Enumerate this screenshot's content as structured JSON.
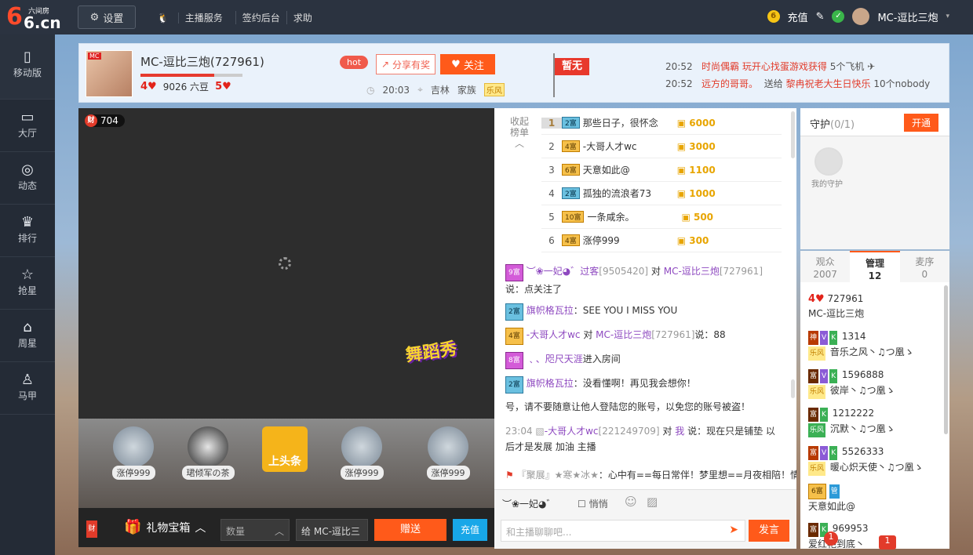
{
  "logo": {
    "text": "6.cn",
    "sub": "六间房"
  },
  "topbar": {
    "settings": "设置",
    "nav": [
      "主播服务",
      "签约后台",
      "求助"
    ],
    "recharge": "充值",
    "username": "MC-逗比三炮"
  },
  "leftnav": [
    {
      "label": "移动版",
      "icon": "phone-icon"
    },
    {
      "label": "大厅",
      "icon": "tv-icon"
    },
    {
      "label": "动态",
      "icon": "compass-icon"
    },
    {
      "label": "排行",
      "icon": "crown-icon"
    },
    {
      "label": "抢星",
      "icon": "star-icon"
    },
    {
      "label": "周星",
      "icon": "gift-icon"
    },
    {
      "label": "马甲",
      "icon": "shirt-icon"
    }
  ],
  "header": {
    "name": "MC-逗比三炮(727961)",
    "level_left": "4",
    "beans": "9026 六豆",
    "level_right": "5",
    "hot": "hot",
    "share": "分享有奖",
    "follow": "关注",
    "time": "20:03",
    "location": "吉林",
    "family_label": "家族",
    "family": "乐风",
    "flag": "暂无",
    "progress": 0.72
  },
  "news": [
    {
      "time": "20:52",
      "red": "时尚偶霸 玩开心找蛋游戏获得",
      "black": "5个飞机"
    },
    {
      "time": "20:52",
      "red": "远方的哥哥。",
      "black": "送给",
      "red2": "黎冉祝老大生日快乐",
      "black2": "10个nobody"
    }
  ],
  "video": {
    "rich_label": "财",
    "rich_count": "704",
    "overlay": "舞蹈秀"
  },
  "gifts": [
    {
      "label": "涨停999"
    },
    {
      "label": "珺倾军の茶"
    },
    {
      "label": "上头条"
    },
    {
      "label": "涨停999"
    },
    {
      "label": "涨停999"
    }
  ],
  "giftbar": {
    "cai": "财",
    "giftbox": "礼物宝箱",
    "qty_placeholder": "数量",
    "to_label": "给",
    "to_name": "MC-逗比三",
    "send": "赠送",
    "recharge": "充值"
  },
  "rank": {
    "toggle": "收起榜单",
    "rows": [
      {
        "no": "1",
        "badge": "2富",
        "name": "那些日子，很怀念",
        "coins": "6000"
      },
      {
        "no": "2",
        "badge": "4富",
        "name": "-大哥人才wc",
        "coins": "3000"
      },
      {
        "no": "3",
        "badge": "6富",
        "name": "天意如此@",
        "coins": "1100"
      },
      {
        "no": "4",
        "badge": "2富",
        "name": "孤独的流浪者73",
        "coins": "1000"
      },
      {
        "no": "5",
        "badge": "10富",
        "name": "一条咸余。",
        "coins": "500"
      },
      {
        "no": "6",
        "badge": "4富",
        "name": "涨停999",
        "coins": "300"
      }
    ]
  },
  "chat": [
    {
      "badge": "9富",
      "who": "︶❀一妃◕゛过客",
      "id": "[9505420]",
      "to": "对",
      "target": "MC-逗比三炮",
      "tid": "[727961]",
      "msg": "说：点关注了"
    },
    {
      "badge": "2富",
      "who": "旗帜格瓦拉",
      "msg": "：SEE YOU I MISS YOU"
    },
    {
      "badge": "4富",
      "who": "-大哥人才wc",
      "to": "对",
      "target": "MC-逗比三炮",
      "tid": "[727961]",
      "msg": "说：88"
    },
    {
      "badge": "8富",
      "who": "﹑、咫尺天涯",
      "msg": "进入房间"
    },
    {
      "badge": "2富",
      "who": "旗帜格瓦拉",
      "msg": "：没看懂啊！再见我会想你！"
    },
    {
      "warn": "号，请不要随意让他人登陆您的账号，以免您的账号被盗！"
    },
    {
      "time": "23:04",
      "who": "-大哥人才wc",
      "id": "[221249709]",
      "to": "对",
      "target": "我",
      "msg": "说：现在只是铺垫 以后才是发展 加油 主播"
    },
    {
      "who": "『聚展』★寒★冰★",
      "msg": "：心中有==每日常伴！梦里想==月夜相陪！情"
    }
  ],
  "chatbar": {
    "sender": "︶❀一妃◕゛",
    "quiet": "悄悄",
    "placeholder": "和主播聊聊吧...",
    "send": "发言"
  },
  "guard": {
    "title": "守护",
    "count": "(0/1)",
    "open": "开通",
    "placeholder": "我的守护"
  },
  "usertabs": [
    {
      "label": "观众",
      "count": "2007"
    },
    {
      "label": "管理",
      "count": "12"
    },
    {
      "label": "麦序",
      "count": "0"
    }
  ],
  "users": [
    {
      "level": "4",
      "id": "727961",
      "name": "MC-逗比三炮"
    },
    {
      "rank": "神",
      "id": "1314",
      "name": "音乐之风丶♫つ凰ゝ",
      "family": "乐风"
    },
    {
      "rank": "富",
      "id": "1596888",
      "name": "彼岸丶♫つ凰ゝ",
      "family": "乐风"
    },
    {
      "rank": "富",
      "id": "1212222",
      "name": "沉默丶♫つ凰ゝ",
      "family": "乐风"
    },
    {
      "rank": "富",
      "id": "5526333",
      "name": "暖心炽天使丶♫つ凰ゝ",
      "family": "乐风"
    },
    {
      "rank": "6富",
      "id": "",
      "name": "天意如此@",
      "family": ""
    },
    {
      "rank": "富",
      "id": "969953",
      "name": "爱红艳到底丶",
      "family": ""
    }
  ],
  "notices": {
    "a": "1",
    "b": "1"
  }
}
